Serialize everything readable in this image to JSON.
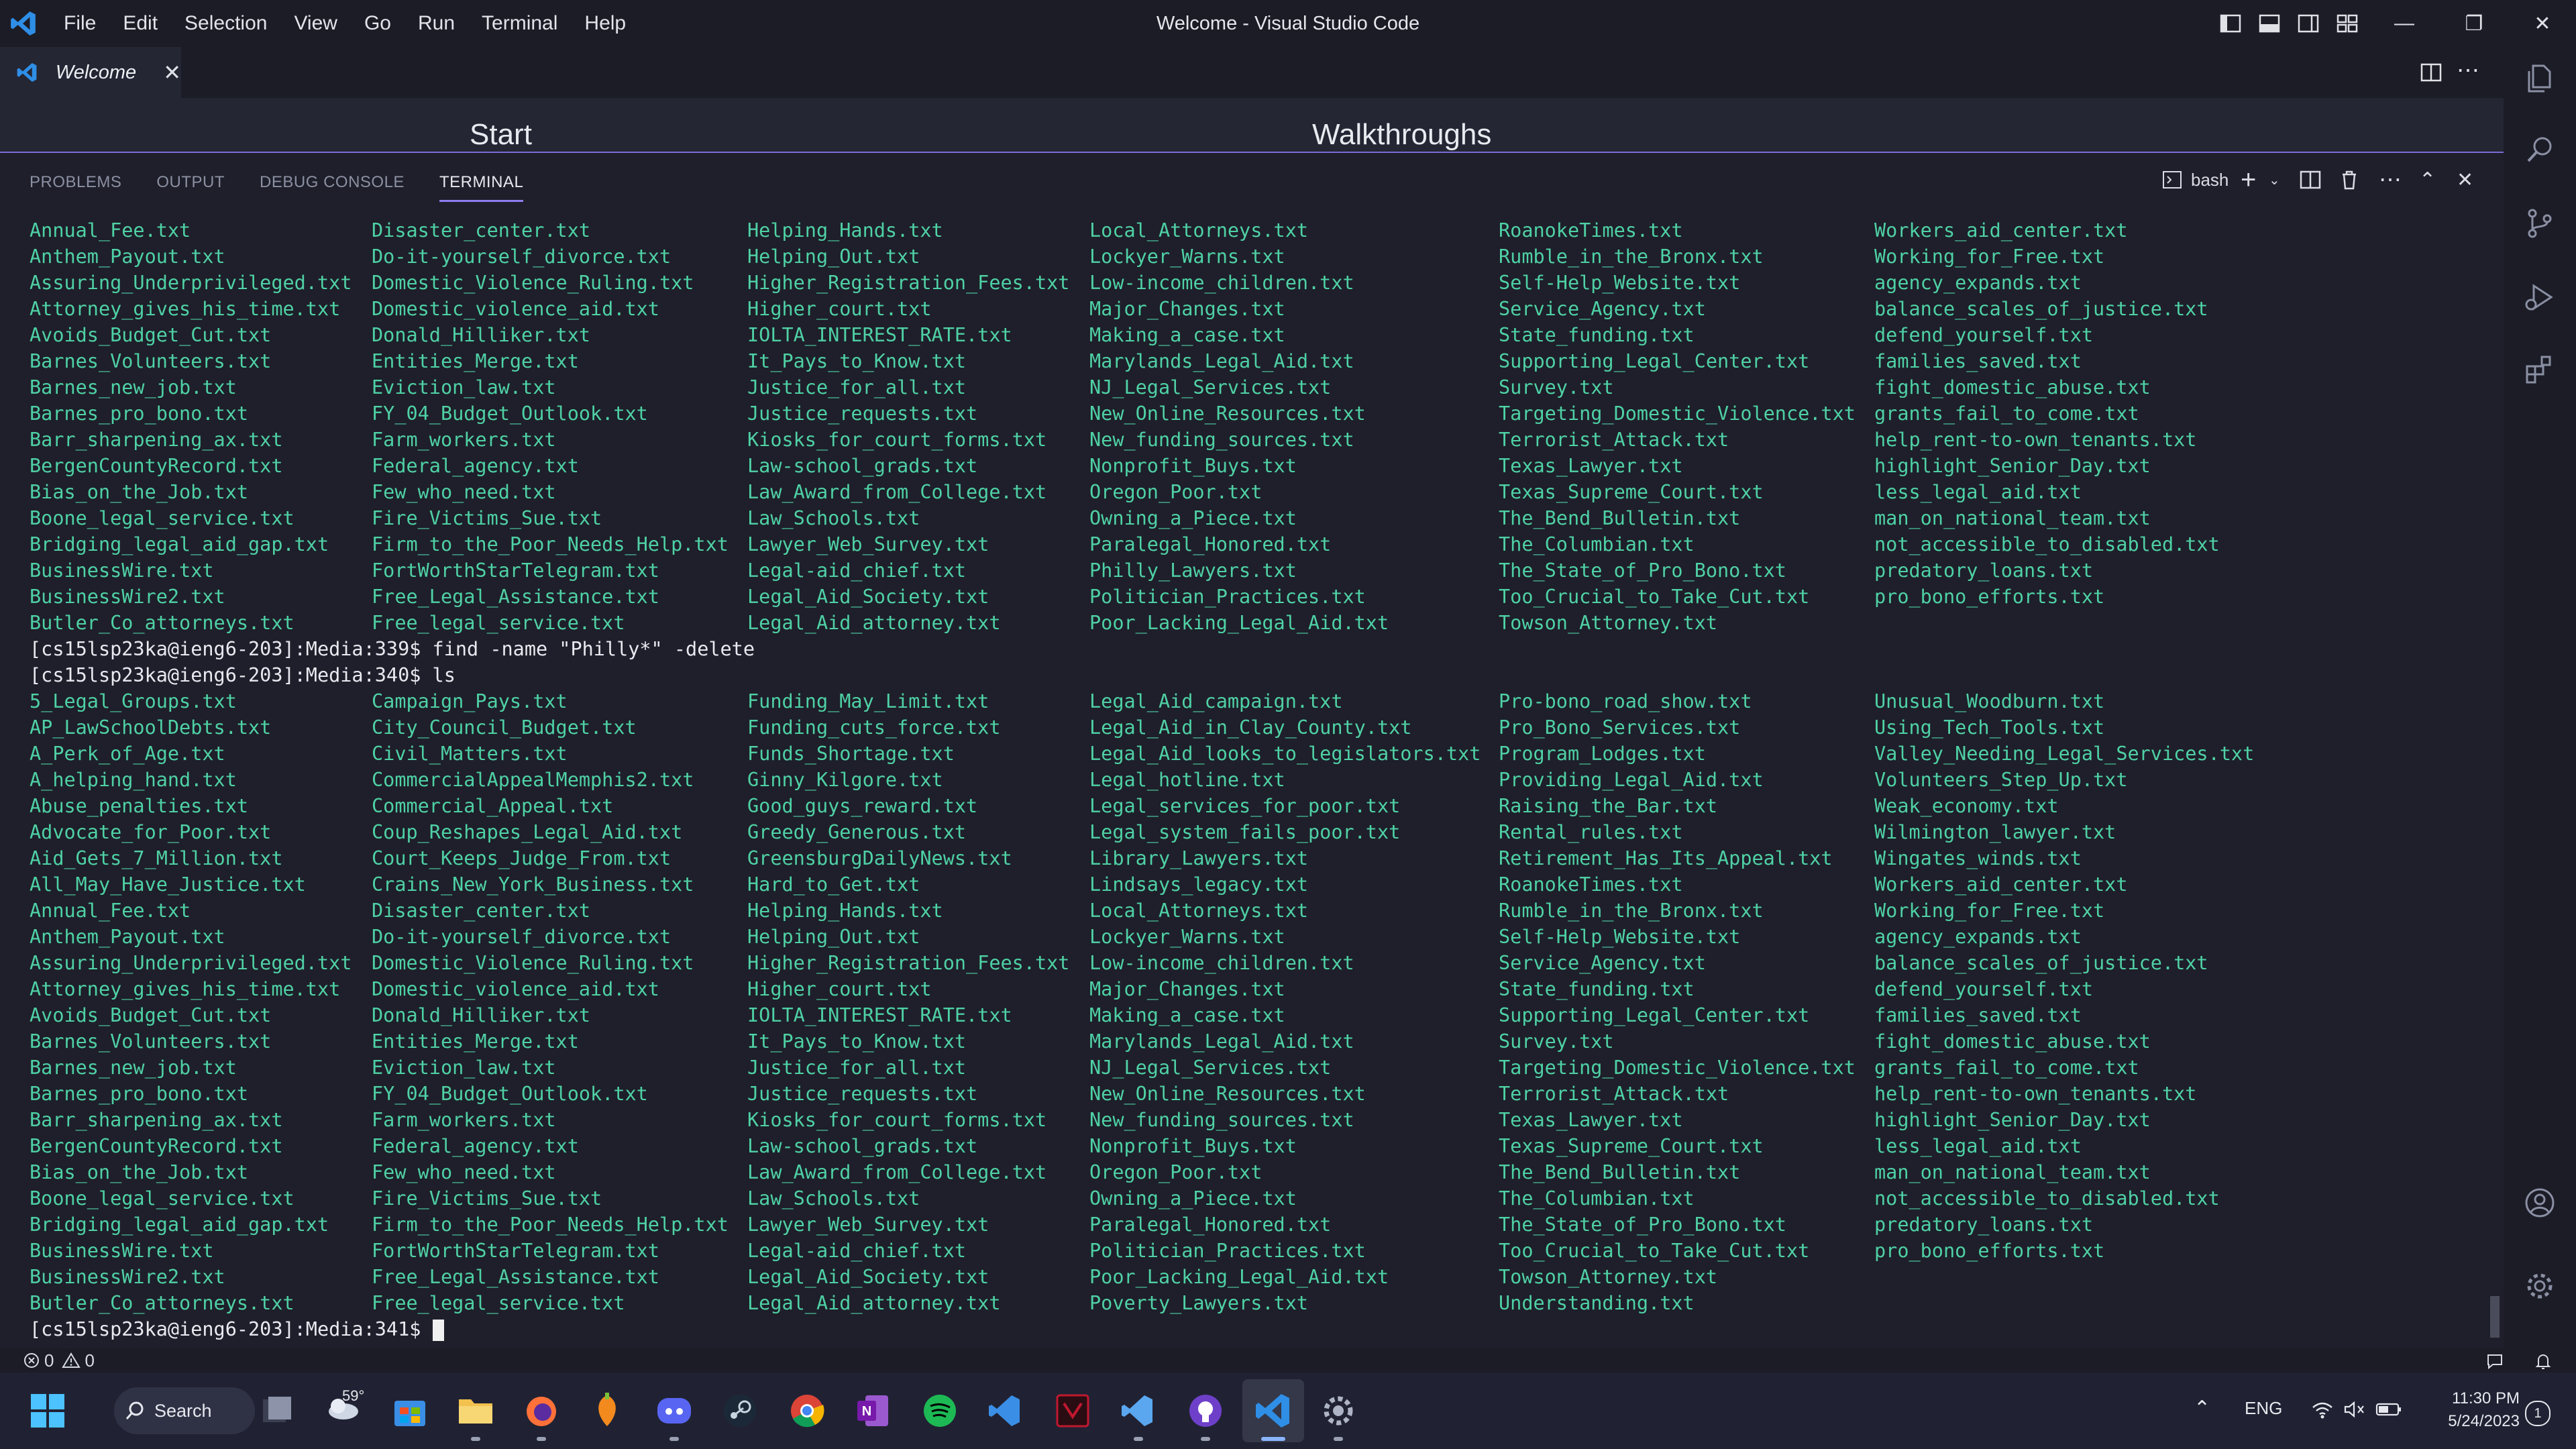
{
  "window": {
    "title": "Welcome - Visual Studio Code"
  },
  "menu": [
    "File",
    "Edit",
    "Selection",
    "View",
    "Go",
    "Run",
    "Terminal",
    "Help"
  ],
  "tab": {
    "label": "Welcome"
  },
  "editor": {
    "start_heading": "Start",
    "walkthroughs_heading": "Walkthroughs"
  },
  "panel": {
    "tabs": [
      "PROBLEMS",
      "OUTPUT",
      "DEBUG CONSOLE",
      "TERMINAL"
    ],
    "active_tab": "TERMINAL",
    "shell_label": "bash"
  },
  "terminal": {
    "listing_top": [
      [
        "Annual_Fee.txt",
        "Disaster_center.txt",
        "Helping_Hands.txt",
        "Local_Attorneys.txt",
        "RoanokeTimes.txt",
        "Workers_aid_center.txt"
      ],
      [
        "Anthem_Payout.txt",
        "Do-it-yourself_divorce.txt",
        "Helping_Out.txt",
        "Lockyer_Warns.txt",
        "Rumble_in_the_Bronx.txt",
        "Working_for_Free.txt"
      ],
      [
        "Assuring_Underprivileged.txt",
        "Domestic_Violence_Ruling.txt",
        "Higher_Registration_Fees.txt",
        "Low-income_children.txt",
        "Self-Help_Website.txt",
        "agency_expands.txt"
      ],
      [
        "Attorney_gives_his_time.txt",
        "Domestic_violence_aid.txt",
        "Higher_court.txt",
        "Major_Changes.txt",
        "Service_Agency.txt",
        "balance_scales_of_justice.txt"
      ],
      [
        "Avoids_Budget_Cut.txt",
        "Donald_Hilliker.txt",
        "IOLTA_INTEREST_RATE.txt",
        "Making_a_case.txt",
        "State_funding.txt",
        "defend_yourself.txt"
      ],
      [
        "Barnes_Volunteers.txt",
        "Entities_Merge.txt",
        "It_Pays_to_Know.txt",
        "Marylands_Legal_Aid.txt",
        "Supporting_Legal_Center.txt",
        "families_saved.txt"
      ],
      [
        "Barnes_new_job.txt",
        "Eviction_law.txt",
        "Justice_for_all.txt",
        "NJ_Legal_Services.txt",
        "Survey.txt",
        "fight_domestic_abuse.txt"
      ],
      [
        "Barnes_pro_bono.txt",
        "FY_04_Budget_Outlook.txt",
        "Justice_requests.txt",
        "New_Online_Resources.txt",
        "Targeting_Domestic_Violence.txt",
        "grants_fail_to_come.txt"
      ],
      [
        "Barr_sharpening_ax.txt",
        "Farm_workers.txt",
        "Kiosks_for_court_forms.txt",
        "New_funding_sources.txt",
        "Terrorist_Attack.txt",
        "help_rent-to-own_tenants.txt"
      ],
      [
        "BergenCountyRecord.txt",
        "Federal_agency.txt",
        "Law-school_grads.txt",
        "Nonprofit_Buys.txt",
        "Texas_Lawyer.txt",
        "highlight_Senior_Day.txt"
      ],
      [
        "Bias_on_the_Job.txt",
        "Few_who_need.txt",
        "Law_Award_from_College.txt",
        "Oregon_Poor.txt",
        "Texas_Supreme_Court.txt",
        "less_legal_aid.txt"
      ],
      [
        "Boone_legal_service.txt",
        "Fire_Victims_Sue.txt",
        "Law_Schools.txt",
        "Owning_a_Piece.txt",
        "The_Bend_Bulletin.txt",
        "man_on_national_team.txt"
      ],
      [
        "Bridging_legal_aid_gap.txt",
        "Firm_to_the_Poor_Needs_Help.txt",
        "Lawyer_Web_Survey.txt",
        "Paralegal_Honored.txt",
        "The_Columbian.txt",
        "not_accessible_to_disabled.txt"
      ],
      [
        "BusinessWire.txt",
        "FortWorthStarTelegram.txt",
        "Legal-aid_chief.txt",
        "Philly_Lawyers.txt",
        "The_State_of_Pro_Bono.txt",
        "predatory_loans.txt"
      ],
      [
        "BusinessWire2.txt",
        "Free_Legal_Assistance.txt",
        "Legal_Aid_Society.txt",
        "Politician_Practices.txt",
        "Too_Crucial_to_Take_Cut.txt",
        "pro_bono_efforts.txt"
      ],
      [
        "Butler_Co_attorneys.txt",
        "Free_legal_service.txt",
        "Legal_Aid_attorney.txt",
        "Poor_Lacking_Legal_Aid.txt",
        "Towson_Attorney.txt",
        ""
      ]
    ],
    "cmd1": "[cs15lsp23ka@ieng6-203]:Media:339$ find -name \"Philly*\" -delete",
    "cmd2": "[cs15lsp23ka@ieng6-203]:Media:340$ ls",
    "listing_bottom": [
      [
        "5_Legal_Groups.txt",
        "Campaign_Pays.txt",
        "Funding_May_Limit.txt",
        "Legal_Aid_campaign.txt",
        "Pro-bono_road_show.txt",
        "Unusual_Woodburn.txt"
      ],
      [
        "AP_LawSchoolDebts.txt",
        "City_Council_Budget.txt",
        "Funding_cuts_force.txt",
        "Legal_Aid_in_Clay_County.txt",
        "Pro_Bono_Services.txt",
        "Using_Tech_Tools.txt"
      ],
      [
        "A_Perk_of_Age.txt",
        "Civil_Matters.txt",
        "Funds_Shortage.txt",
        "Legal_Aid_looks_to_legislators.txt",
        "Program_Lodges.txt",
        "Valley_Needing_Legal_Services.txt"
      ],
      [
        "A_helping_hand.txt",
        "CommercialAppealMemphis2.txt",
        "Ginny_Kilgore.txt",
        "Legal_hotline.txt",
        "Providing_Legal_Aid.txt",
        "Volunteers_Step_Up.txt"
      ],
      [
        "Abuse_penalties.txt",
        "Commercial_Appeal.txt",
        "Good_guys_reward.txt",
        "Legal_services_for_poor.txt",
        "Raising_the_Bar.txt",
        "Weak_economy.txt"
      ],
      [
        "Advocate_for_Poor.txt",
        "Coup_Reshapes_Legal_Aid.txt",
        "Greedy_Generous.txt",
        "Legal_system_fails_poor.txt",
        "Rental_rules.txt",
        "Wilmington_lawyer.txt"
      ],
      [
        "Aid_Gets_7_Million.txt",
        "Court_Keeps_Judge_From.txt",
        "GreensburgDailyNews.txt",
        "Library_Lawyers.txt",
        "Retirement_Has_Its_Appeal.txt",
        "Wingates_winds.txt"
      ],
      [
        "All_May_Have_Justice.txt",
        "Crains_New_York_Business.txt",
        "Hard_to_Get.txt",
        "Lindsays_legacy.txt",
        "RoanokeTimes.txt",
        "Workers_aid_center.txt"
      ],
      [
        "Annual_Fee.txt",
        "Disaster_center.txt",
        "Helping_Hands.txt",
        "Local_Attorneys.txt",
        "Rumble_in_the_Bronx.txt",
        "Working_for_Free.txt"
      ],
      [
        "Anthem_Payout.txt",
        "Do-it-yourself_divorce.txt",
        "Helping_Out.txt",
        "Lockyer_Warns.txt",
        "Self-Help_Website.txt",
        "agency_expands.txt"
      ],
      [
        "Assuring_Underprivileged.txt",
        "Domestic_Violence_Ruling.txt",
        "Higher_Registration_Fees.txt",
        "Low-income_children.txt",
        "Service_Agency.txt",
        "balance_scales_of_justice.txt"
      ],
      [
        "Attorney_gives_his_time.txt",
        "Domestic_violence_aid.txt",
        "Higher_court.txt",
        "Major_Changes.txt",
        "State_funding.txt",
        "defend_yourself.txt"
      ],
      [
        "Avoids_Budget_Cut.txt",
        "Donald_Hilliker.txt",
        "IOLTA_INTEREST_RATE.txt",
        "Making_a_case.txt",
        "Supporting_Legal_Center.txt",
        "families_saved.txt"
      ],
      [
        "Barnes_Volunteers.txt",
        "Entities_Merge.txt",
        "It_Pays_to_Know.txt",
        "Marylands_Legal_Aid.txt",
        "Survey.txt",
        "fight_domestic_abuse.txt"
      ],
      [
        "Barnes_new_job.txt",
        "Eviction_law.txt",
        "Justice_for_all.txt",
        "NJ_Legal_Services.txt",
        "Targeting_Domestic_Violence.txt",
        "grants_fail_to_come.txt"
      ],
      [
        "Barnes_pro_bono.txt",
        "FY_04_Budget_Outlook.txt",
        "Justice_requests.txt",
        "New_Online_Resources.txt",
        "Terrorist_Attack.txt",
        "help_rent-to-own_tenants.txt"
      ],
      [
        "Barr_sharpening_ax.txt",
        "Farm_workers.txt",
        "Kiosks_for_court_forms.txt",
        "New_funding_sources.txt",
        "Texas_Lawyer.txt",
        "highlight_Senior_Day.txt"
      ],
      [
        "BergenCountyRecord.txt",
        "Federal_agency.txt",
        "Law-school_grads.txt",
        "Nonprofit_Buys.txt",
        "Texas_Supreme_Court.txt",
        "less_legal_aid.txt"
      ],
      [
        "Bias_on_the_Job.txt",
        "Few_who_need.txt",
        "Law_Award_from_College.txt",
        "Oregon_Poor.txt",
        "The_Bend_Bulletin.txt",
        "man_on_national_team.txt"
      ],
      [
        "Boone_legal_service.txt",
        "Fire_Victims_Sue.txt",
        "Law_Schools.txt",
        "Owning_a_Piece.txt",
        "The_Columbian.txt",
        "not_accessible_to_disabled.txt"
      ],
      [
        "Bridging_legal_aid_gap.txt",
        "Firm_to_the_Poor_Needs_Help.txt",
        "Lawyer_Web_Survey.txt",
        "Paralegal_Honored.txt",
        "The_State_of_Pro_Bono.txt",
        "predatory_loans.txt"
      ],
      [
        "BusinessWire.txt",
        "FortWorthStarTelegram.txt",
        "Legal-aid_chief.txt",
        "Politician_Practices.txt",
        "Too_Crucial_to_Take_Cut.txt",
        "pro_bono_efforts.txt"
      ],
      [
        "BusinessWire2.txt",
        "Free_Legal_Assistance.txt",
        "Legal_Aid_Society.txt",
        "Poor_Lacking_Legal_Aid.txt",
        "Towson_Attorney.txt",
        ""
      ],
      [
        "Butler_Co_attorneys.txt",
        "Free_legal_service.txt",
        "Legal_Aid_attorney.txt",
        "Poverty_Lawyers.txt",
        "Understanding.txt",
        ""
      ]
    ],
    "prompt": "[cs15lsp23ka@ieng6-203]:Media:341$ "
  },
  "statusbar": {
    "errors": "0",
    "warnings": "0"
  },
  "taskbar": {
    "search_label": "Search",
    "weather_temp": "59°",
    "language": "ENG",
    "time": "11:30 PM",
    "date": "5/24/2023",
    "notification_count": "1"
  },
  "colors": {
    "accent": "#8e7cf0",
    "file_green": "#4fd1a5",
    "vscode_blue": "#2f8ee6"
  }
}
